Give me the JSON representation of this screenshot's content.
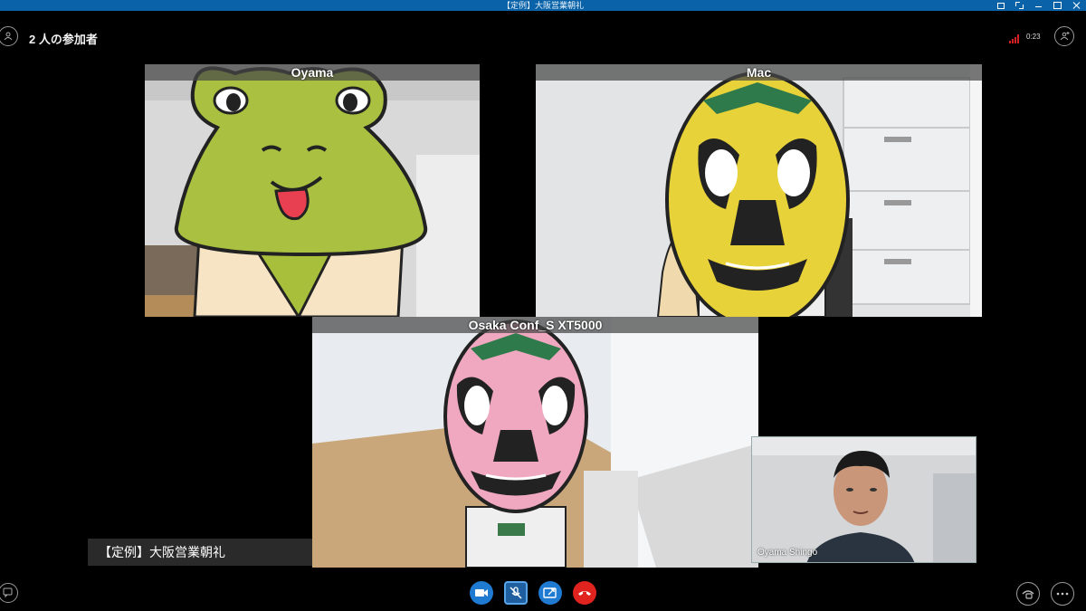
{
  "window": {
    "title": "【定例】大阪営業朝礼"
  },
  "header": {
    "participants": "2 人の参加者",
    "timer": "0:23"
  },
  "tiles": [
    {
      "name": "Oyama"
    },
    {
      "name": "Mac"
    },
    {
      "name": "Osaka Conf_S XT5000"
    }
  ],
  "self_view": {
    "name": "Oyama Shingo"
  },
  "meeting": {
    "title": "【定例】大阪営業朝礼"
  },
  "controls": {
    "video": "video-camera-icon",
    "mic": "microphone-muted-icon",
    "share": "share-screen-icon",
    "hangup": "hang-up-icon",
    "chat": "chat-icon",
    "devices": "call-devices-icon",
    "more": "more-options-icon"
  },
  "colors": {
    "titlebar": "#0a63a8",
    "accent": "#1f7ad1",
    "hangup": "#e0231f",
    "signal": "#d42020"
  }
}
